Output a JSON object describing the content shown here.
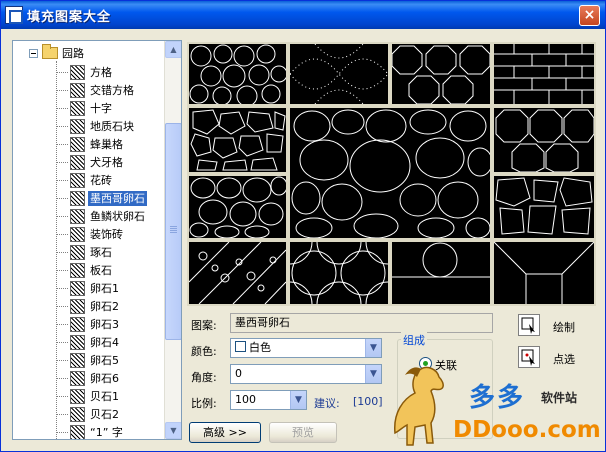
{
  "window": {
    "title": "填充图案大全",
    "close_glyph": "×"
  },
  "tree": {
    "root_label": "园路",
    "items": [
      {
        "label": "方格",
        "selected": false
      },
      {
        "label": "交错方格",
        "selected": false
      },
      {
        "label": "十字",
        "selected": false
      },
      {
        "label": "地质石块",
        "selected": false
      },
      {
        "label": "蜂巢格",
        "selected": false
      },
      {
        "label": "犬牙格",
        "selected": false
      },
      {
        "label": "花砖",
        "selected": false
      },
      {
        "label": "墨西哥卵石",
        "selected": true
      },
      {
        "label": "鱼鳞状卵石",
        "selected": false
      },
      {
        "label": "装饰砖",
        "selected": false
      },
      {
        "label": "琢石",
        "selected": false
      },
      {
        "label": "板石",
        "selected": false
      },
      {
        "label": "卵石1",
        "selected": false
      },
      {
        "label": "卵石2",
        "selected": false
      },
      {
        "label": "卵石3",
        "selected": false
      },
      {
        "label": "卵石4",
        "selected": false
      },
      {
        "label": "卵石5",
        "selected": false
      },
      {
        "label": "卵石6",
        "selected": false
      },
      {
        "label": "贝石1",
        "selected": false
      },
      {
        "label": "贝石2",
        "selected": false
      },
      {
        "label": "“1” 字",
        "selected": false
      }
    ]
  },
  "preview": {
    "cells": [
      "stone",
      "dotted-arcs",
      "octagons",
      "bricks",
      "crazy-paving",
      "mexican-pebbles",
      "octagon-grid",
      "large-pebbles",
      "diagonal-stones",
      "scallops",
      "single-circle",
      "diagonal-lines"
    ]
  },
  "form": {
    "pattern_label": "图案:",
    "pattern_value": "墨西哥卵石",
    "color_label": "颜色:",
    "color_value": "白色",
    "angle_label": "角度:",
    "angle_value": "0",
    "scale_label": "比例:",
    "scale_value": "100",
    "suggest_label": "建议:",
    "suggest_value": "[100]",
    "advanced_button": "高级 >>",
    "preview_button": "预览",
    "group_title": "组成",
    "radio_label": "关联",
    "draw_button": "绘制",
    "pick_button": "点选"
  },
  "watermark": {
    "cn": "多多",
    "sub": "软件站",
    "url": "DDooo.com"
  }
}
